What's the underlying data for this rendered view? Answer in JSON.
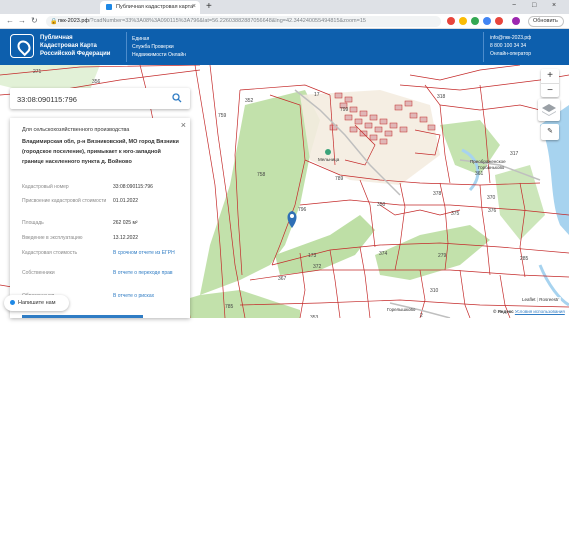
{
  "browser": {
    "tab_title": "Публичная кадастровая карта",
    "url_host": "пкк-2023.рф",
    "url_rest": "/?cadNumber=33%3A08%3A090115%3A796&lat=56.22603882887056648&lng=42.344240055494815&zoom=15",
    "update_label": "Обновить",
    "ext_badge": "4"
  },
  "header": {
    "brand_lines": [
      "Публичная",
      "Кадастровая Карта",
      "Российской Федерации"
    ],
    "service_lines": [
      "Единая",
      "Служба Проверки",
      "Недвижимости Онлайн"
    ],
    "email": "info@пкк-2023.рф",
    "phone": "8 800 100 34 34",
    "operator": "Онлайн-оператор"
  },
  "search": {
    "value": "33:08:090115:796"
  },
  "panel": {
    "purpose": "Для сельскохозяйственного производства",
    "address": "Владимирская обл, р-н Вязниковский, МО город Вязники (городское поселение), примыкает к юго-западной границе населенного пункта д. Войново",
    "rows": [
      {
        "label": "Кадастровый номер",
        "value": "33:08:090115:796"
      },
      {
        "label": "Присвоение кадастровой стоимости",
        "value": "01.01.2022"
      },
      {
        "label": "Площадь",
        "value": "262 025 м²"
      },
      {
        "label": "Введение в эксплуатацию",
        "value": "13.12.2022"
      },
      {
        "label": "Кадастровая стоимость",
        "value": "В срочном отчете из ЕГРН"
      },
      {
        "label": "Собственники",
        "value": "В отчете о переходе прав"
      },
      {
        "label": "Обременения",
        "value": "В отчете о рисках"
      }
    ]
  },
  "chat": {
    "label": "Напишите нам"
  },
  "map": {
    "zoom_in": "+",
    "zoom_out": "−",
    "attribution_left": "Leaflet",
    "attribution_right": "Rosreestr",
    "yandex_prefix": "© Яндекс",
    "yandex_link": "Условия использования",
    "places": [
      "Мельница",
      "Преображенское",
      "Горбаньково",
      "Горелышково"
    ],
    "parcel_labels": [
      "271",
      "356",
      "352",
      "17",
      "799",
      "318",
      "759",
      "758",
      "796",
      "789",
      "317",
      "370",
      "375",
      "376",
      "350",
      "374",
      "378",
      "279",
      "173",
      "372",
      "367",
      "785",
      "353",
      "285",
      "310",
      "361",
      "2"
    ]
  },
  "colors": {
    "header_blue": "#0d5fad",
    "parcel_red": "#c42a2a",
    "forest_green": "#b7dc9c",
    "water_blue": "#a7d3ef",
    "accent_blue": "#2f7cc4"
  }
}
